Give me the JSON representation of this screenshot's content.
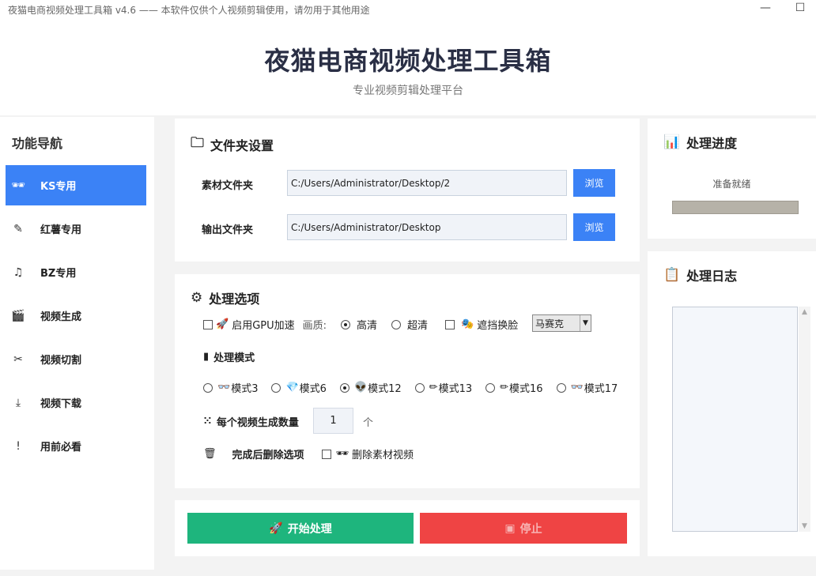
{
  "window": {
    "title": "夜猫电商视频处理工具箱 v4.6 —— 本软件仅供个人视频剪辑使用，请勿用于其他用途",
    "minimize": "—",
    "maximize": "☐"
  },
  "header": {
    "title": "夜猫电商视频处理工具箱",
    "subtitle": "专业视频剪辑处理平台"
  },
  "sidebar": {
    "title": "功能导航",
    "items": [
      {
        "label": "KS专用",
        "icon": "🕶"
      },
      {
        "label": "红薯专用",
        "icon": "✎"
      },
      {
        "label": "BZ专用",
        "icon": "♫"
      },
      {
        "label": "视频生成",
        "icon": "🎬"
      },
      {
        "label": "视频切割",
        "icon": "✂"
      },
      {
        "label": "视频下载",
        "icon": "⤓"
      },
      {
        "label": "用前必看",
        "icon": "!"
      }
    ]
  },
  "folder": {
    "title": "文件夹设置",
    "icon": "🗀",
    "source_label": "素材文件夹",
    "source_value": "C:/Users/Administrator/Desktop/2",
    "output_label": "输出文件夹",
    "output_value": "C:/Users/Administrator/Desktop",
    "browse": "浏览"
  },
  "options": {
    "title": "处理选项",
    "icon": "⚙",
    "gpu_label": "启用GPU加速",
    "gpu_icon": "🚀",
    "quality_label": "画质:",
    "quality_hd": "高清",
    "quality_uhd": "超清",
    "mask_label": "遮挡换脸",
    "mask_icon": "🎭",
    "mask_select": "马赛克",
    "mode_title": "处理模式",
    "mode_icon": "▮",
    "modes": [
      {
        "label": "模式3",
        "icon": "👓"
      },
      {
        "label": "模式6",
        "icon": "💎"
      },
      {
        "label": "模式12",
        "icon": "👽"
      },
      {
        "label": "模式13",
        "icon": "✏"
      },
      {
        "label": "模式16",
        "icon": "✏"
      },
      {
        "label": "模式17",
        "icon": "👓"
      }
    ],
    "count_label": "每个视频生成数量",
    "count_icon": "⁙",
    "count_value": "1",
    "count_unit": "个",
    "delete_title": "完成后删除选项",
    "delete_icon": "🗑",
    "delete_label": "删除素材视频",
    "delete_item_icon": "🕶"
  },
  "actions": {
    "start": "开始处理",
    "start_icon": "🚀",
    "stop": "停止",
    "stop_icon": "▣",
    "start_color": "#1eb57d",
    "stop_color": "#ef4444"
  },
  "progress": {
    "title": "处理进度",
    "icon": "📊",
    "status": "准备就绪"
  },
  "log": {
    "title": "处理日志",
    "icon": "📋"
  }
}
